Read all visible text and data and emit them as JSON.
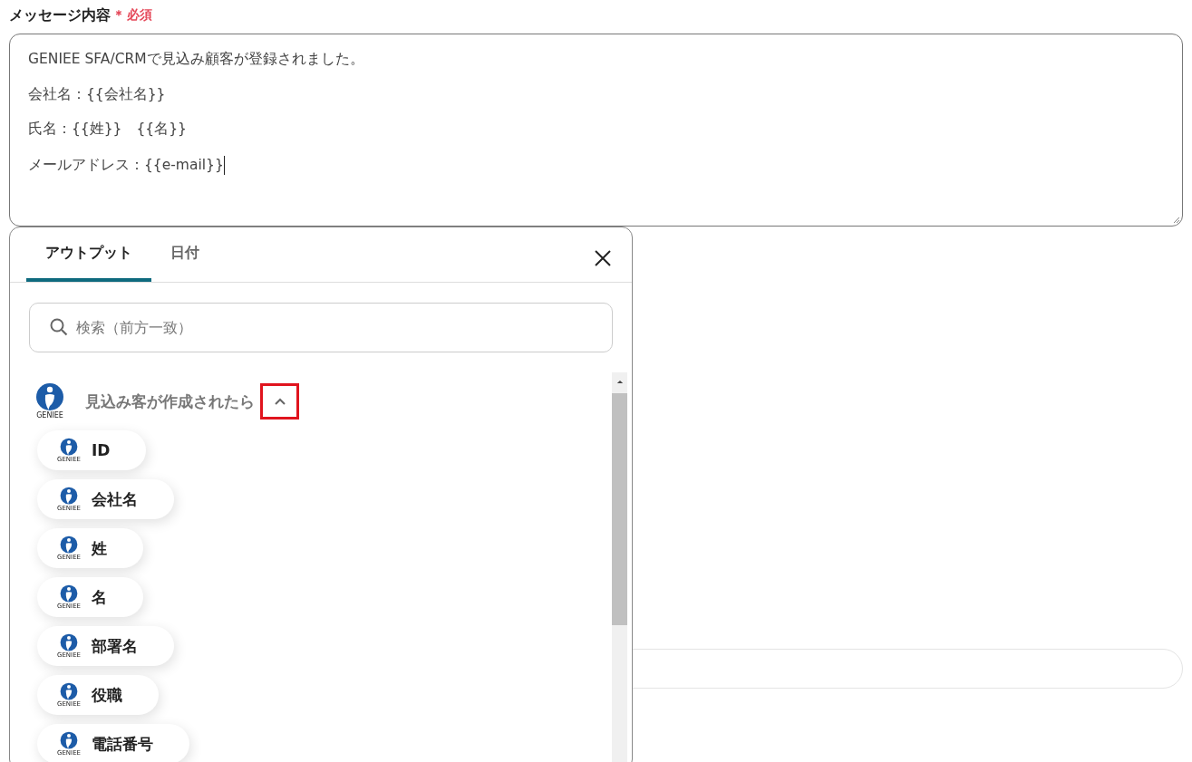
{
  "field": {
    "label": "メッセージ内容",
    "required_mark": "＊",
    "required_text": "必須"
  },
  "message": {
    "lines": [
      "GENIEE SFA/CRMで見込み顧客が登録されました。",
      "会社名：{{会社名}}",
      "氏名：{{姓}}　{{名}}",
      "メールアドレス：{{e-mail}}"
    ],
    "focused": true
  },
  "popup": {
    "tabs": [
      {
        "label": "アウトプット",
        "selected": true
      },
      {
        "label": "日付",
        "selected": false
      }
    ],
    "search": {
      "placeholder": "検索（前方一致）"
    },
    "group": {
      "logo_text": "GENIEE",
      "title": "見込み客が作成されたら",
      "expanded": true,
      "highlighted": true,
      "items": [
        {
          "label": "ID",
          "logo_text": "GENIEE"
        },
        {
          "label": "会社名",
          "logo_text": "GENIEE"
        },
        {
          "label": "姓",
          "logo_text": "GENIEE"
        },
        {
          "label": "名",
          "logo_text": "GENIEE"
        },
        {
          "label": "部署名",
          "logo_text": "GENIEE"
        },
        {
          "label": "役職",
          "logo_text": "GENIEE"
        },
        {
          "label": "電話番号",
          "logo_text": "GENIEE"
        }
      ]
    }
  }
}
